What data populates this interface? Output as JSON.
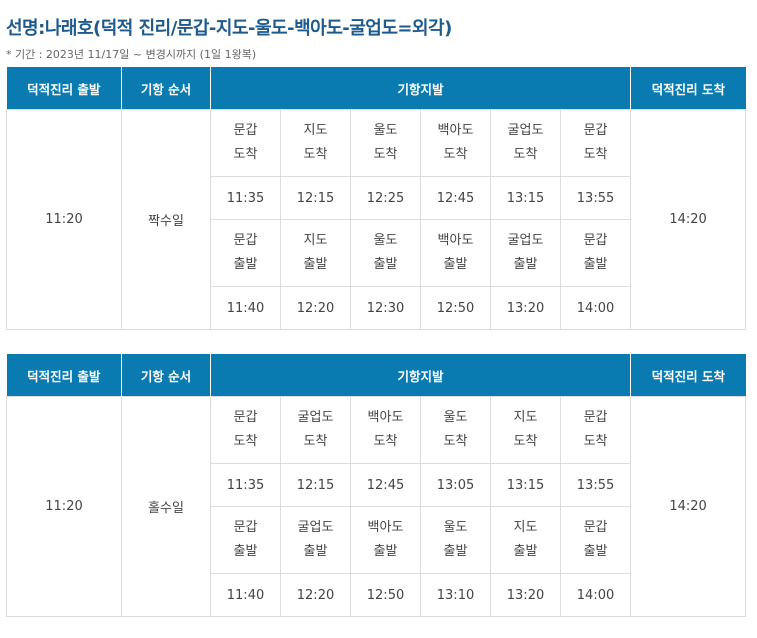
{
  "title": "선명:나래호(덕적 진리/문갑-지도-울도-백아도-굴업도=외각)",
  "subtitle": "* 기간 : 2023년 11/17일 ~ 변경시까지 (1일 1왕복)",
  "tables": [
    {
      "headers": [
        "덕적진리 출발",
        "기항 순서",
        "기항지발",
        "덕적진리 도착"
      ],
      "depart": "11:20",
      "order": "짝수일",
      "arrive": "14:20",
      "arrival_row": [
        {
          "name": "문갑",
          "type": "도착"
        },
        {
          "name": "지도",
          "type": "도착"
        },
        {
          "name": "울도",
          "type": "도착"
        },
        {
          "name": "백아도",
          "type": "도착"
        },
        {
          "name": "굴업도",
          "type": "도착"
        },
        {
          "name": "문갑",
          "type": "도착"
        }
      ],
      "arrival_times": [
        "11:35",
        "12:15",
        "12:25",
        "12:45",
        "13:15",
        "13:55"
      ],
      "depart_row": [
        {
          "name": "문갑",
          "type": "출발"
        },
        {
          "name": "지도",
          "type": "출발"
        },
        {
          "name": "울도",
          "type": "출발"
        },
        {
          "name": "백아도",
          "type": "출발"
        },
        {
          "name": "굴업도",
          "type": "출발"
        },
        {
          "name": "문갑",
          "type": "출발"
        }
      ],
      "depart_times": [
        "11:40",
        "12:20",
        "12:30",
        "12:50",
        "13:20",
        "14:00"
      ]
    },
    {
      "headers": [
        "덕적진리 출발",
        "기항 순서",
        "기항지발",
        "덕적진리 도착"
      ],
      "depart": "11:20",
      "order": "홀수일",
      "arrive": "14:20",
      "arrival_row": [
        {
          "name": "문갑",
          "type": "도착"
        },
        {
          "name": "굴업도",
          "type": "도착"
        },
        {
          "name": "백아도",
          "type": "도착"
        },
        {
          "name": "울도",
          "type": "도착"
        },
        {
          "name": "지도",
          "type": "도착"
        },
        {
          "name": "문갑",
          "type": "도착"
        }
      ],
      "arrival_times": [
        "11:35",
        "12:15",
        "12:45",
        "13:05",
        "13:15",
        "13:55"
      ],
      "depart_row": [
        {
          "name": "문갑",
          "type": "출발"
        },
        {
          "name": "굴업도",
          "type": "출발"
        },
        {
          "name": "백아도",
          "type": "출발"
        },
        {
          "name": "울도",
          "type": "출발"
        },
        {
          "name": "지도",
          "type": "출발"
        },
        {
          "name": "문갑",
          "type": "출발"
        }
      ],
      "depart_times": [
        "11:40",
        "12:20",
        "12:50",
        "13:10",
        "13:20",
        "14:00"
      ]
    }
  ]
}
